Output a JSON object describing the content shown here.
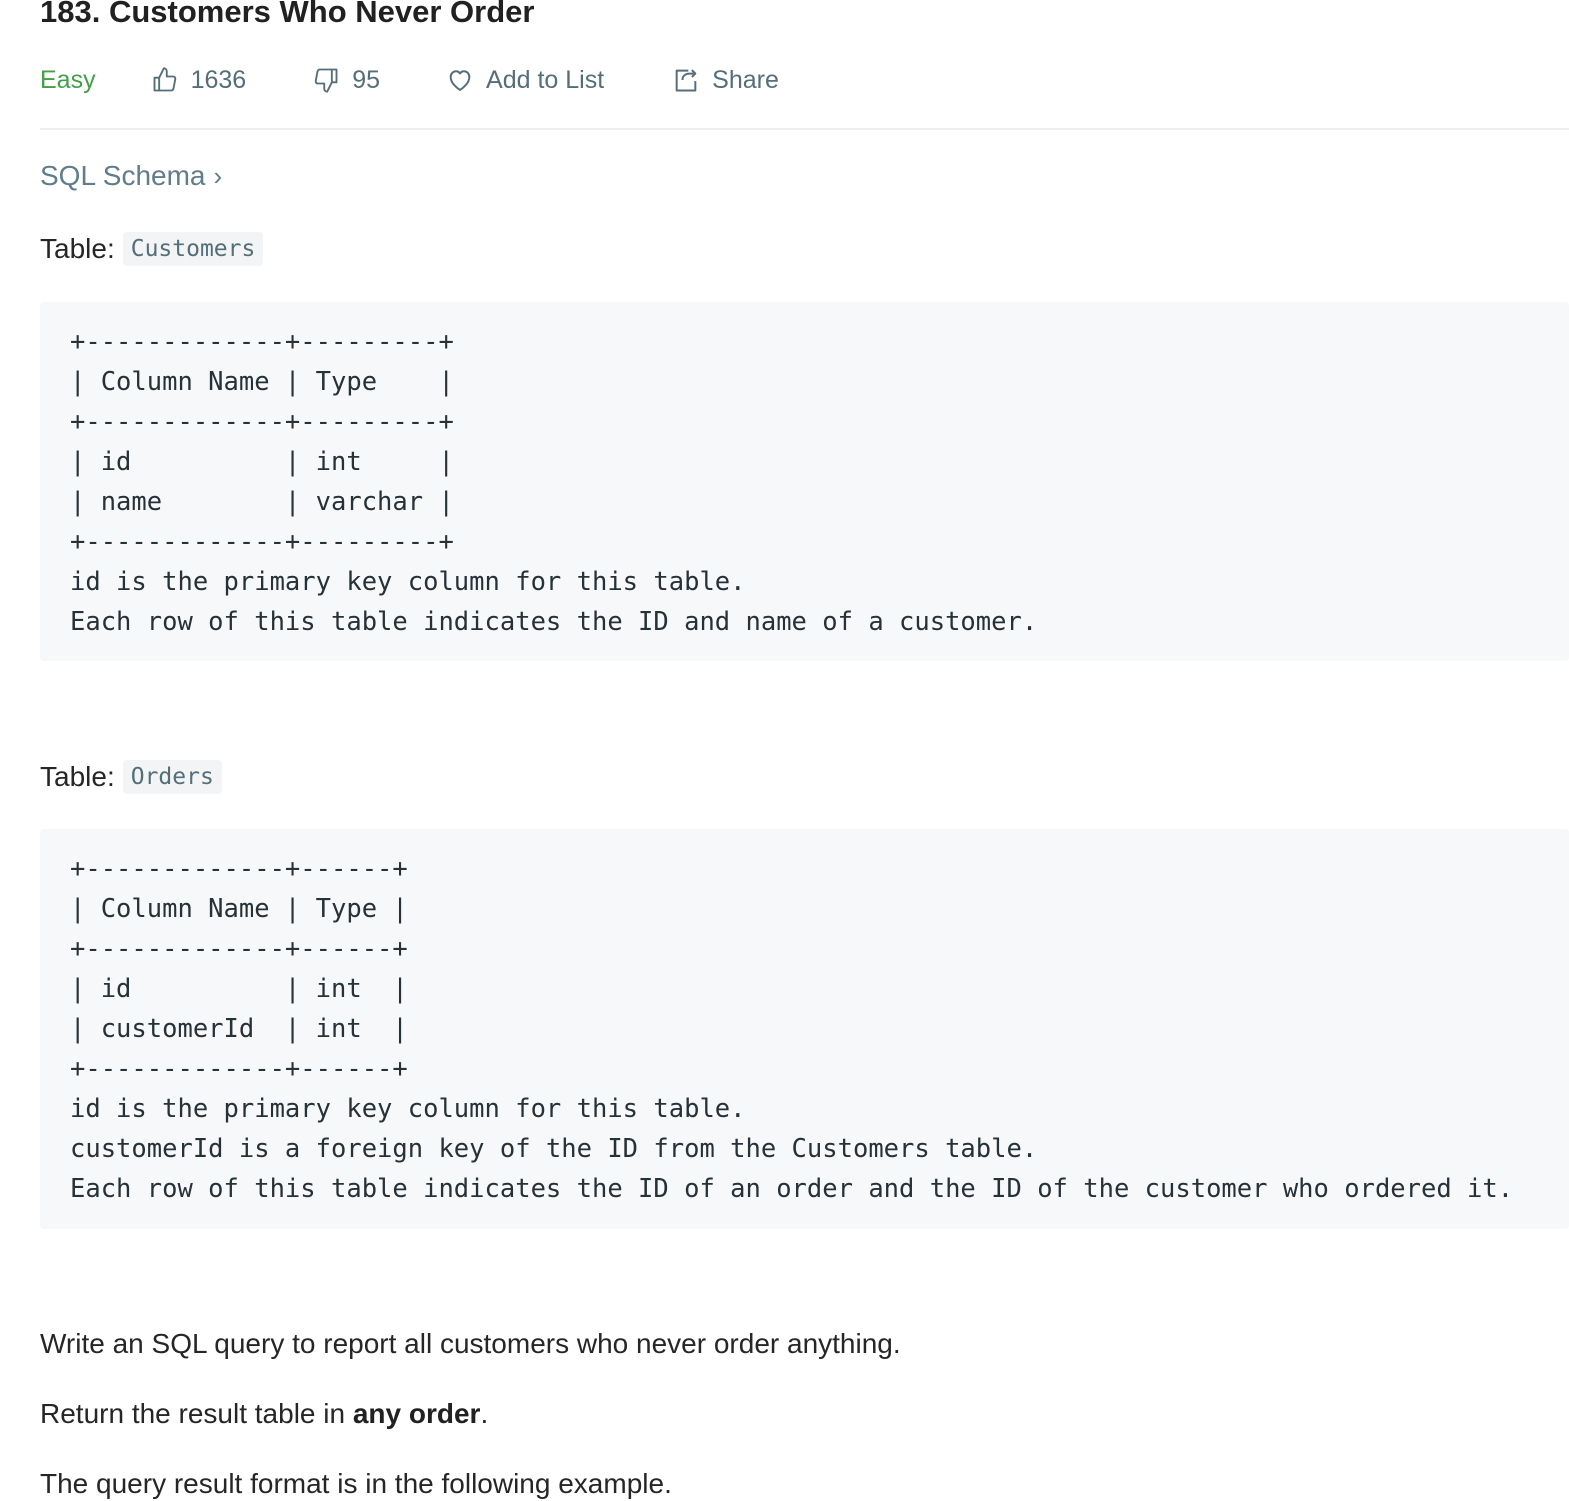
{
  "problem": {
    "title": "183. Customers Who Never Order",
    "difficulty": "Easy",
    "likes": "1636",
    "dislikes": "95",
    "add_to_list": "Add to List",
    "share": "Share",
    "icons": {
      "like": "thumbs-up-icon",
      "dislike": "thumbs-down-icon",
      "add": "heart-icon",
      "share": "share-icon"
    },
    "colors": {
      "easy": "#43a047",
      "muted": "#546e7a",
      "code_bg": "#f7f8fa"
    }
  },
  "schema_link": "SQL Schema",
  "schema_chevron": "›",
  "tables": [
    {
      "label": "Table:",
      "name": "Customers",
      "code": "+-------------+---------+\n| Column Name | Type    |\n+-------------+---------+\n| id          | int     |\n| name        | varchar |\n+-------------+---------+\nid is the primary key column for this table.\nEach row of this table indicates the ID and name of a customer."
    },
    {
      "label": "Table:",
      "name": "Orders",
      "code": "+-------------+------+\n| Column Name | Type |\n+-------------+------+\n| id          | int  |\n| customerId  | int  |\n+-------------+------+\nid is the primary key column for this table.\ncustomerId is a foreign key of the ID from the Customers table.\nEach row of this table indicates the ID of an order and the ID of the customer who ordered it."
    }
  ],
  "description": {
    "line1": "Write an SQL query to report all customers who never order anything.",
    "line2_prefix": "Return the result table in ",
    "line2_bold": "any order",
    "line2_suffix": ".",
    "line3": "The query result format is in the following example."
  }
}
